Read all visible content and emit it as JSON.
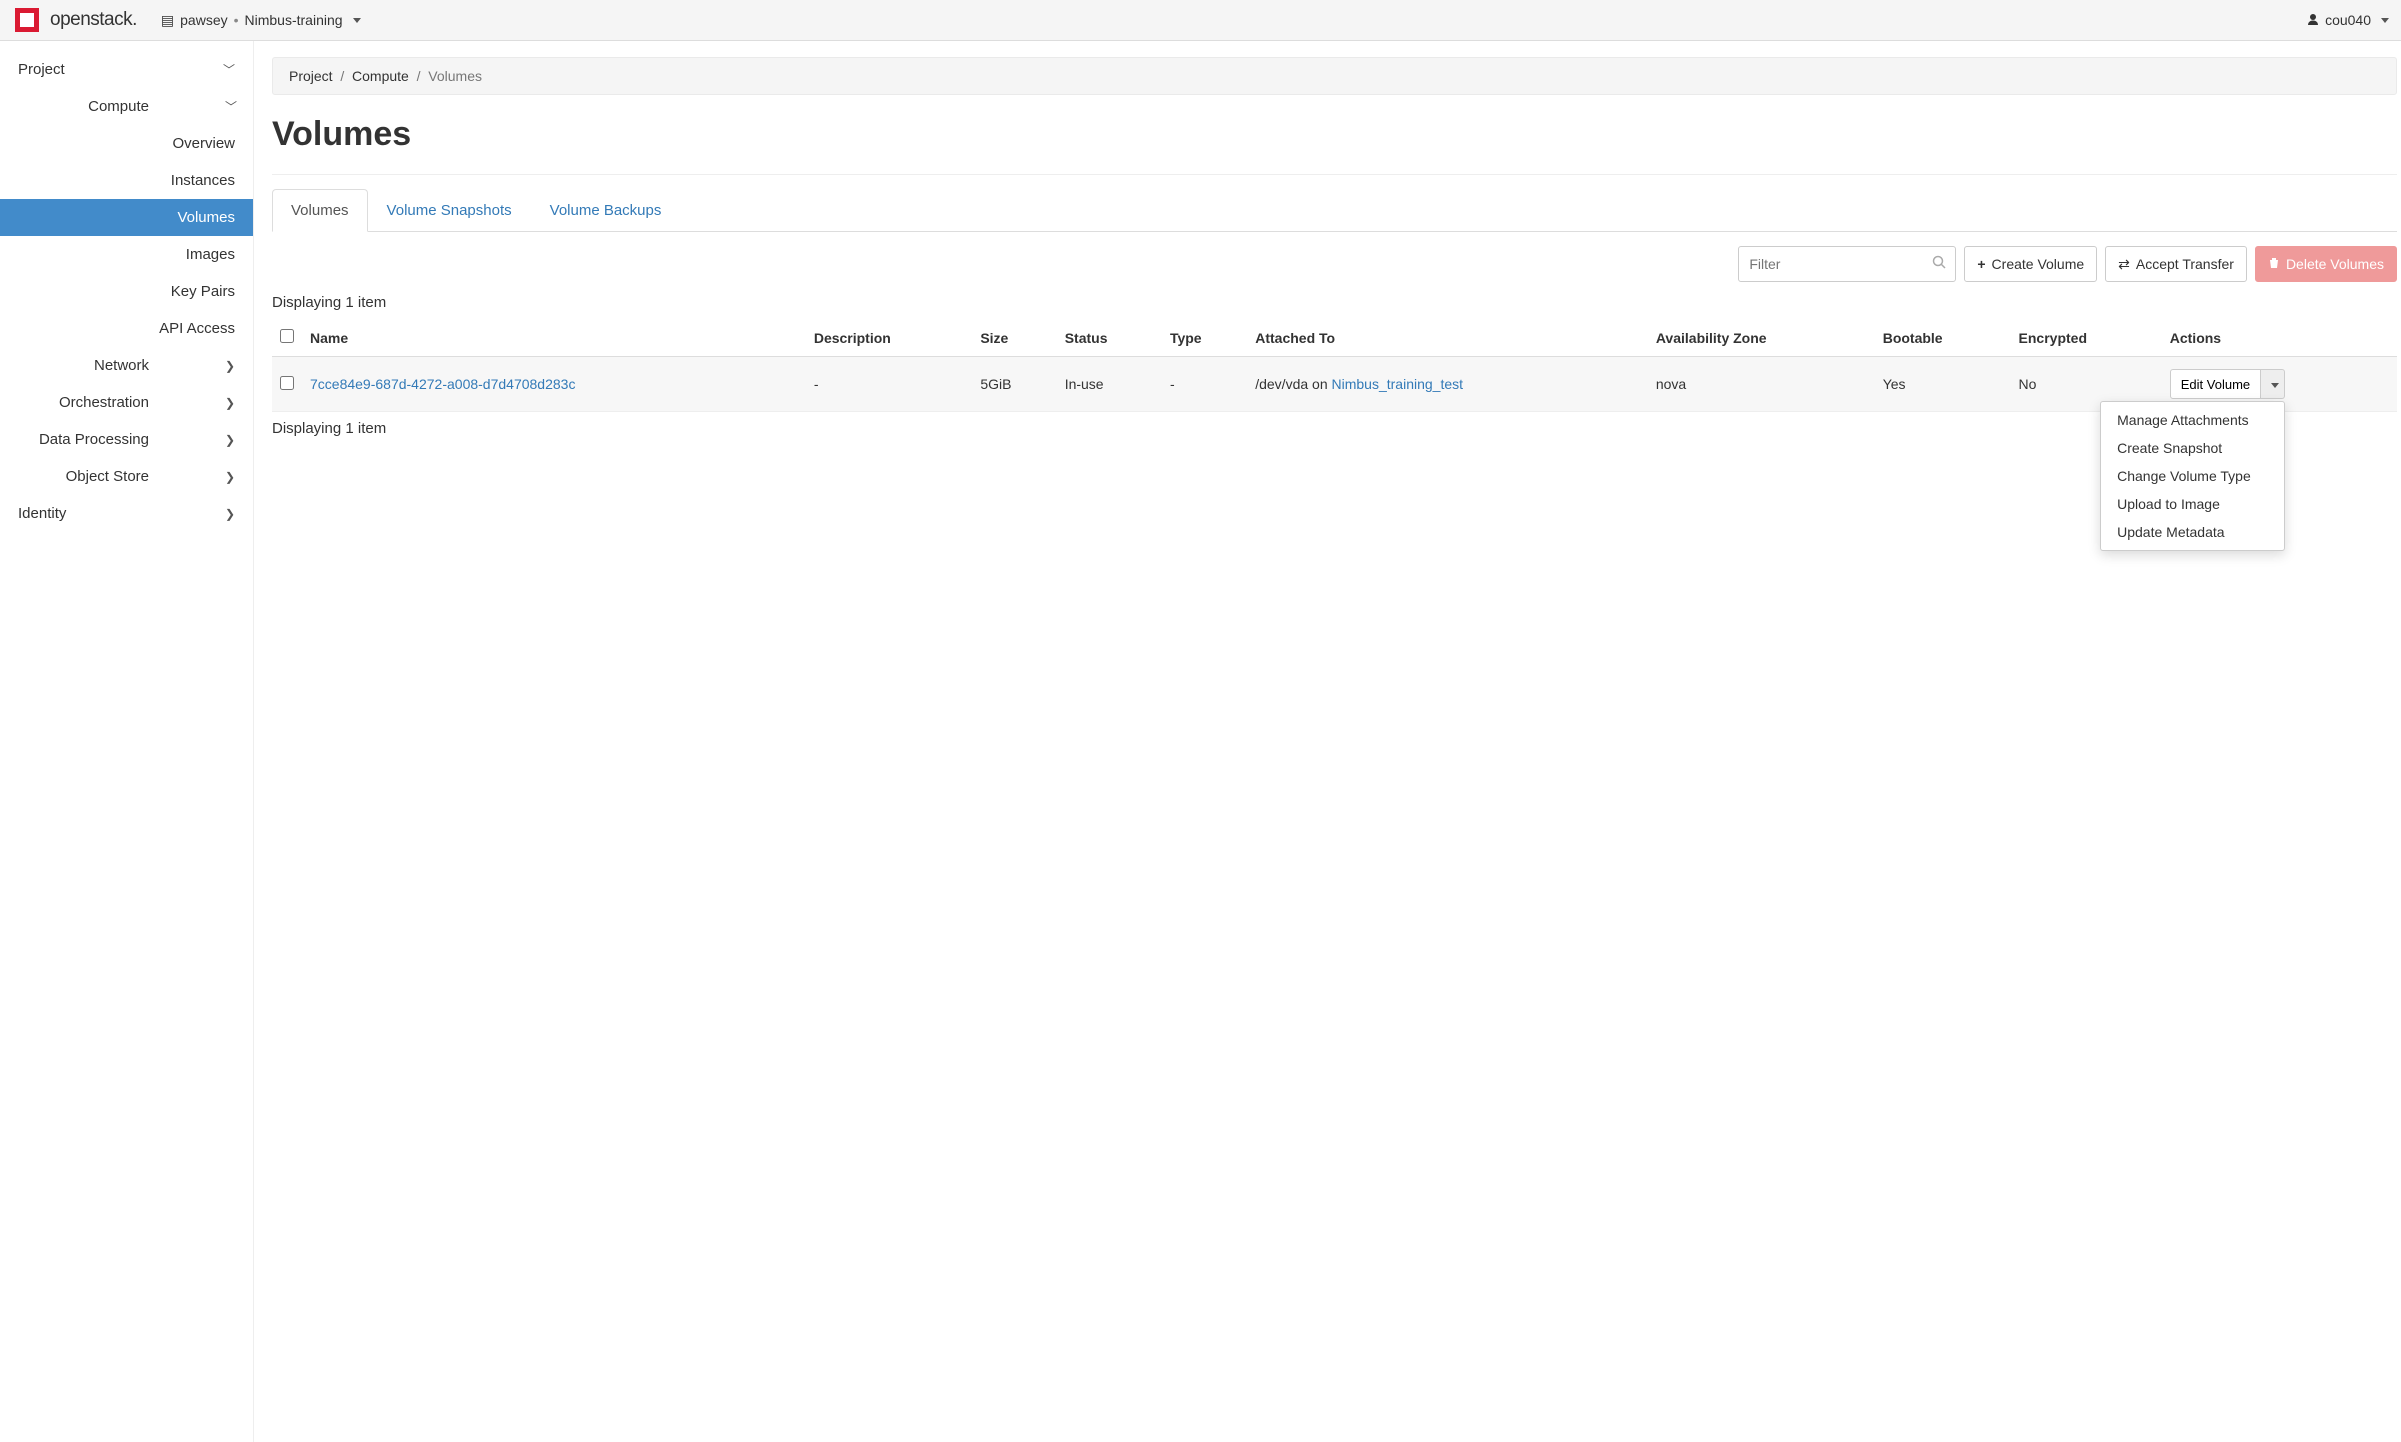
{
  "brand": {
    "name": "openstack."
  },
  "context": {
    "domain": "pawsey",
    "project": "Nimbus-training"
  },
  "user": {
    "name": "cou040"
  },
  "sidebar": {
    "project_label": "Project",
    "compute_label": "Compute",
    "compute_items": [
      "Overview",
      "Instances",
      "Volumes",
      "Images",
      "Key Pairs",
      "API Access"
    ],
    "groups": [
      "Network",
      "Orchestration",
      "Data Processing",
      "Object Store"
    ],
    "identity_label": "Identity"
  },
  "breadcrumb": {
    "root": "Project",
    "section": "Compute",
    "page": "Volumes"
  },
  "page_title": "Volumes",
  "tabs": [
    "Volumes",
    "Volume Snapshots",
    "Volume Backups"
  ],
  "toolbar": {
    "filter_placeholder": "Filter",
    "create_label": "Create Volume",
    "accept_label": "Accept Transfer",
    "delete_label": "Delete Volumes"
  },
  "table": {
    "display_text_top": "Displaying 1 item",
    "display_text_bottom": "Displaying 1 item",
    "headers": {
      "name": "Name",
      "description": "Description",
      "size": "Size",
      "status": "Status",
      "type": "Type",
      "attached": "Attached To",
      "az": "Availability Zone",
      "bootable": "Bootable",
      "encrypted": "Encrypted",
      "actions": "Actions"
    },
    "row": {
      "name": "7cce84e9-687d-4272-a008-d7d4708d283c",
      "description": "-",
      "size": "5GiB",
      "status": "In-use",
      "type": "-",
      "attached_prefix": "/dev/vda on ",
      "attached_link": "Nimbus_training_test",
      "az": "nova",
      "bootable": "Yes",
      "encrypted": "No",
      "action_label": "Edit Volume"
    }
  },
  "dropdown": {
    "items": [
      "Manage Attachments",
      "Create Snapshot",
      "Change Volume Type",
      "Upload to Image",
      "Update Metadata"
    ]
  }
}
